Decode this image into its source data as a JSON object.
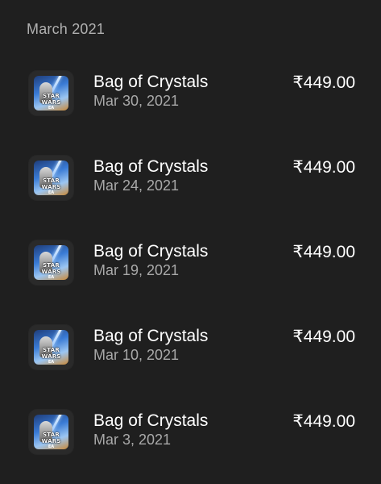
{
  "section": {
    "month_label": "March 2021"
  },
  "app_icon": {
    "wordmark": "STAR WARS",
    "badge": "EA"
  },
  "purchases": [
    {
      "title": "Bag of Crystals",
      "date": "Mar 30, 2021",
      "price": "₹449.00"
    },
    {
      "title": "Bag of Crystals",
      "date": "Mar 24, 2021",
      "price": "₹449.00"
    },
    {
      "title": "Bag of Crystals",
      "date": "Mar 19, 2021",
      "price": "₹449.00"
    },
    {
      "title": "Bag of Crystals",
      "date": "Mar 10, 2021",
      "price": "₹449.00"
    },
    {
      "title": "Bag of Crystals",
      "date": "Mar 3, 2021",
      "price": "₹449.00"
    }
  ]
}
